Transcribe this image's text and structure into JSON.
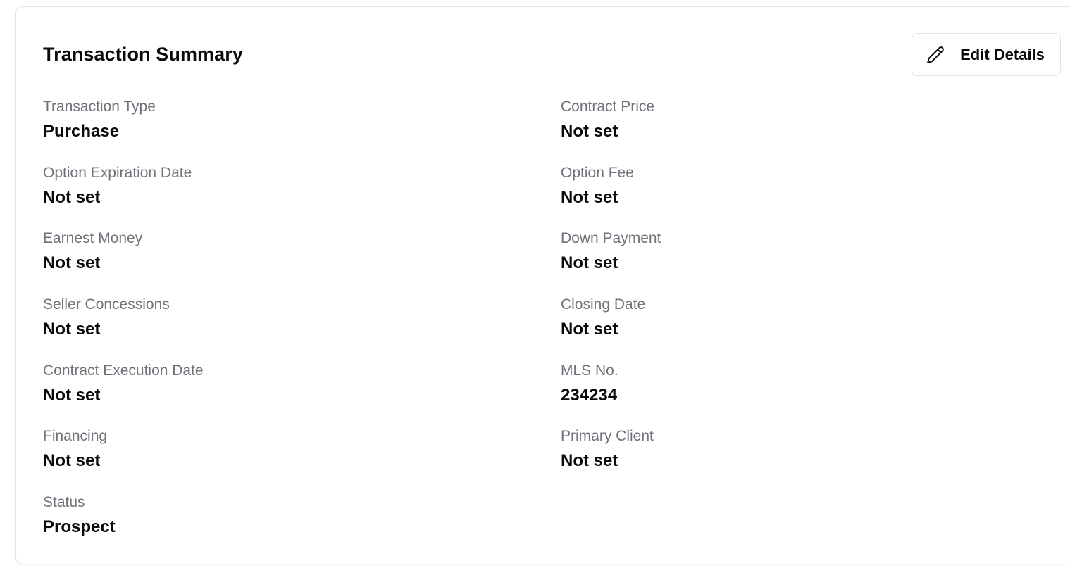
{
  "summary": {
    "title": "Transaction Summary",
    "edit_button": {
      "label": "Edit Details",
      "icon": "pencil-icon"
    },
    "left_fields": [
      {
        "label": "Transaction Type",
        "value": "Purchase"
      },
      {
        "label": "Option Expiration Date",
        "value": "Not set"
      },
      {
        "label": "Earnest Money",
        "value": "Not set"
      },
      {
        "label": "Seller Concessions",
        "value": "Not set"
      },
      {
        "label": "Contract Execution Date",
        "value": "Not set"
      },
      {
        "label": "Financing",
        "value": "Not set"
      },
      {
        "label": "Status",
        "value": "Prospect"
      }
    ],
    "right_fields": [
      {
        "label": "Contract Price",
        "value": "Not set"
      },
      {
        "label": "Option Fee",
        "value": "Not set"
      },
      {
        "label": "Down Payment",
        "value": "Not set"
      },
      {
        "label": "Closing Date",
        "value": "Not set"
      },
      {
        "label": "MLS No.",
        "value": "234234"
      },
      {
        "label": "Primary Client",
        "value": "Not set"
      }
    ]
  }
}
